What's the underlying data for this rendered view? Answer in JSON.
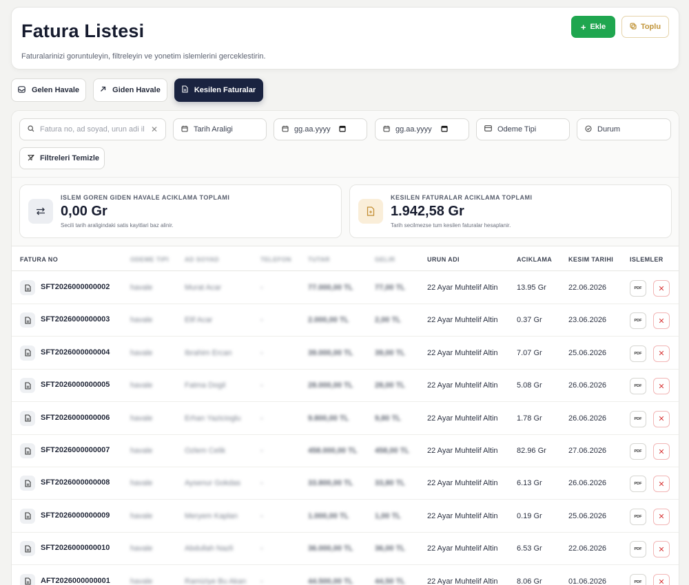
{
  "header": {
    "title": "Fatura Listesi",
    "subtitle": "Faturalarinizi goruntuleyin, filtreleyin ve yonetim islemlerini gerceklestirin.",
    "add_label": "Ekle",
    "bulk_label": "Toplu"
  },
  "tabs": [
    {
      "label": "Gelen Havale",
      "icon": "inbox-icon",
      "active": false
    },
    {
      "label": "Giden Havale",
      "icon": "arrow-up-right-icon",
      "active": false
    },
    {
      "label": "Kesilen Faturalar",
      "icon": "document-icon",
      "active": true
    }
  ],
  "filters": {
    "search_placeholder": "Fatura no, ad soyad, urun adi il",
    "date_range_label": "Tarih Araligi",
    "date_start_placeholder": "gg.aa.yyyy",
    "date_end_placeholder": "gg.aa.yyyy",
    "payment_type_label": "Odeme Tipi",
    "status_label": "Durum",
    "clear_label": "Filtreleri Temizle"
  },
  "summary": [
    {
      "label": "ISLEM GOREN GIDEN HAVALE ACIKLAMA TOPLAMI",
      "value": "0,00 Gr",
      "note": "Secili tarih araligindaki satis kayitlari baz alinir.",
      "icon": "swap-arrows-icon"
    },
    {
      "label": "KESILEN FATURALAR ACIKLAMA TOPLAMI",
      "value": "1.942,58 Gr",
      "note": "Tarih secilmezse tum kesilen faturalar hesaplanir.",
      "icon": "invoice-icon"
    }
  ],
  "table": {
    "columns": [
      "FATURA NO",
      "ODEME TIPI",
      "AD SOYAD",
      "TELEFON",
      "TUTAR",
      "GELIR",
      "URUN ADI",
      "ACIKLAMA",
      "KESIM TARIHI",
      "ISLEMLER"
    ],
    "pdf_label": "PDF",
    "rows": [
      {
        "no": "SFT2026000000002",
        "pay": "havale",
        "name": "Murat Acar",
        "phone": "-",
        "amount": "77.000,00 TL",
        "income": "77,00 TL",
        "product": "22 Ayar Muhtelif Altin",
        "desc": "13.95 Gr",
        "date": "22.06.2026"
      },
      {
        "no": "SFT2026000000003",
        "pay": "havale",
        "name": "Elif Acar",
        "phone": "-",
        "amount": "2.000,00 TL",
        "income": "2,00 TL",
        "product": "22 Ayar Muhtelif Altin",
        "desc": "0.37 Gr",
        "date": "23.06.2026"
      },
      {
        "no": "SFT2026000000004",
        "pay": "havale",
        "name": "Ibrahim Ercan",
        "phone": "-",
        "amount": "39.000,00 TL",
        "income": "39,00 TL",
        "product": "22 Ayar Muhtelif Altin",
        "desc": "7.07 Gr",
        "date": "25.06.2026"
      },
      {
        "no": "SFT2026000000005",
        "pay": "havale",
        "name": "Fatma Dogil",
        "phone": "-",
        "amount": "28.000,00 TL",
        "income": "28,00 TL",
        "product": "22 Ayar Muhtelif Altin",
        "desc": "5.08 Gr",
        "date": "26.06.2026"
      },
      {
        "no": "SFT2026000000006",
        "pay": "havale",
        "name": "Erhan Yazicioglu",
        "phone": "-",
        "amount": "9.800,00 TL",
        "income": "9,80 TL",
        "product": "22 Ayar Muhtelif Altin",
        "desc": "1.78 Gr",
        "date": "26.06.2026"
      },
      {
        "no": "SFT2026000000007",
        "pay": "havale",
        "name": "Ozlem Celik",
        "phone": "-",
        "amount": "458.000,00 TL",
        "income": "458,00 TL",
        "product": "22 Ayar Muhtelif Altin",
        "desc": "82.96 Gr",
        "date": "27.06.2026"
      },
      {
        "no": "SFT2026000000008",
        "pay": "havale",
        "name": "Aysenur Gokdas",
        "phone": "-",
        "amount": "33.800,00 TL",
        "income": "33,80 TL",
        "product": "22 Ayar Muhtelif Altin",
        "desc": "6.13 Gr",
        "date": "26.06.2026"
      },
      {
        "no": "SFT2026000000009",
        "pay": "havale",
        "name": "Meryem Kaplan",
        "phone": "-",
        "amount": "1.000,00 TL",
        "income": "1,00 TL",
        "product": "22 Ayar Muhtelif Altin",
        "desc": "0.19 Gr",
        "date": "25.06.2026"
      },
      {
        "no": "SFT2026000000010",
        "pay": "havale",
        "name": "Abdullah Nazli",
        "phone": "-",
        "amount": "36.000,00 TL",
        "income": "36,00 TL",
        "product": "22 Ayar Muhtelif Altin",
        "desc": "6.53 Gr",
        "date": "22.06.2026"
      },
      {
        "no": "AFT2026000000001",
        "pay": "havale",
        "name": "Ramiziye Bu Akan",
        "phone": "-",
        "amount": "44.500,00 TL",
        "income": "44,50 TL",
        "product": "22 Ayar Muhtelif Altin",
        "desc": "8.06 Gr",
        "date": "01.06.2026"
      }
    ]
  },
  "colors": {
    "primary_dark": "#1a2340",
    "add_green": "#1fa64f",
    "bulk_gold": "#c1953a",
    "delete_red": "#d83a3a"
  }
}
